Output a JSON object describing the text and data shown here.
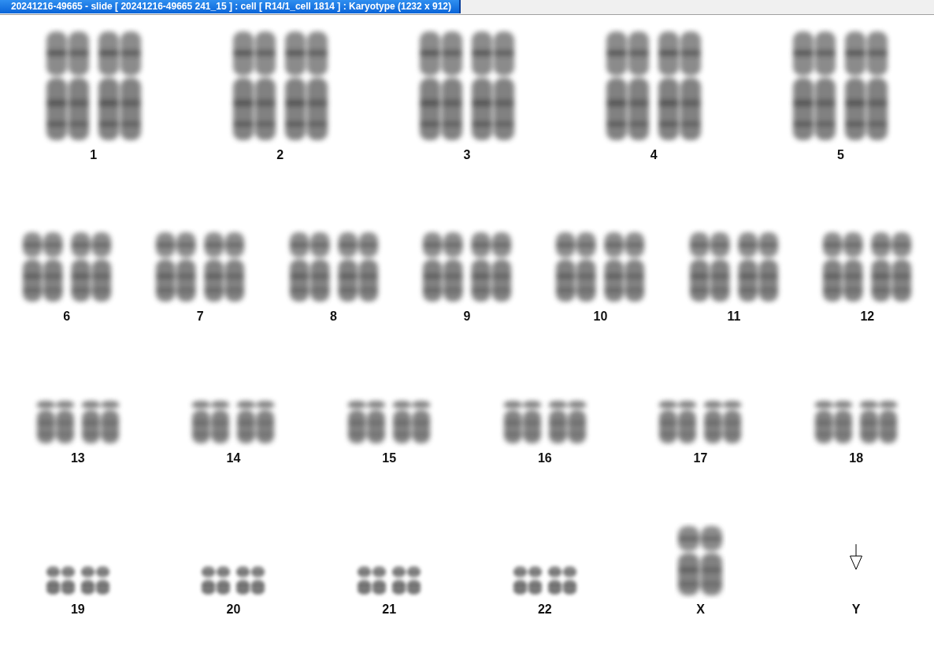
{
  "window": {
    "title": "20241216-49665 - slide [ 20241216-49665 241_15 ] : cell [ R14/1_cell 1814 ] : Karyotype  (1232 x 912)"
  },
  "rows": [
    {
      "items": [
        {
          "label": "1",
          "kind": "pair"
        },
        {
          "label": "2",
          "kind": "pair"
        },
        {
          "label": "3",
          "kind": "pair"
        },
        {
          "label": "4",
          "kind": "pair"
        },
        {
          "label": "5",
          "kind": "pair"
        }
      ]
    },
    {
      "items": [
        {
          "label": "6",
          "kind": "pair"
        },
        {
          "label": "7",
          "kind": "pair"
        },
        {
          "label": "8",
          "kind": "pair"
        },
        {
          "label": "9",
          "kind": "pair"
        },
        {
          "label": "10",
          "kind": "pair"
        },
        {
          "label": "11",
          "kind": "pair"
        },
        {
          "label": "12",
          "kind": "pair"
        }
      ]
    },
    {
      "items": [
        {
          "label": "13",
          "kind": "pair"
        },
        {
          "label": "14",
          "kind": "pair"
        },
        {
          "label": "15",
          "kind": "pair"
        },
        {
          "label": "16",
          "kind": "pair"
        },
        {
          "label": "17",
          "kind": "pair"
        },
        {
          "label": "18",
          "kind": "pair"
        }
      ]
    },
    {
      "items": [
        {
          "label": "19",
          "kind": "pair"
        },
        {
          "label": "20",
          "kind": "pair"
        },
        {
          "label": "21",
          "kind": "pair"
        },
        {
          "label": "22",
          "kind": "pair"
        },
        {
          "label": "X",
          "kind": "single"
        },
        {
          "label": "Y",
          "kind": "missing"
        }
      ]
    }
  ]
}
